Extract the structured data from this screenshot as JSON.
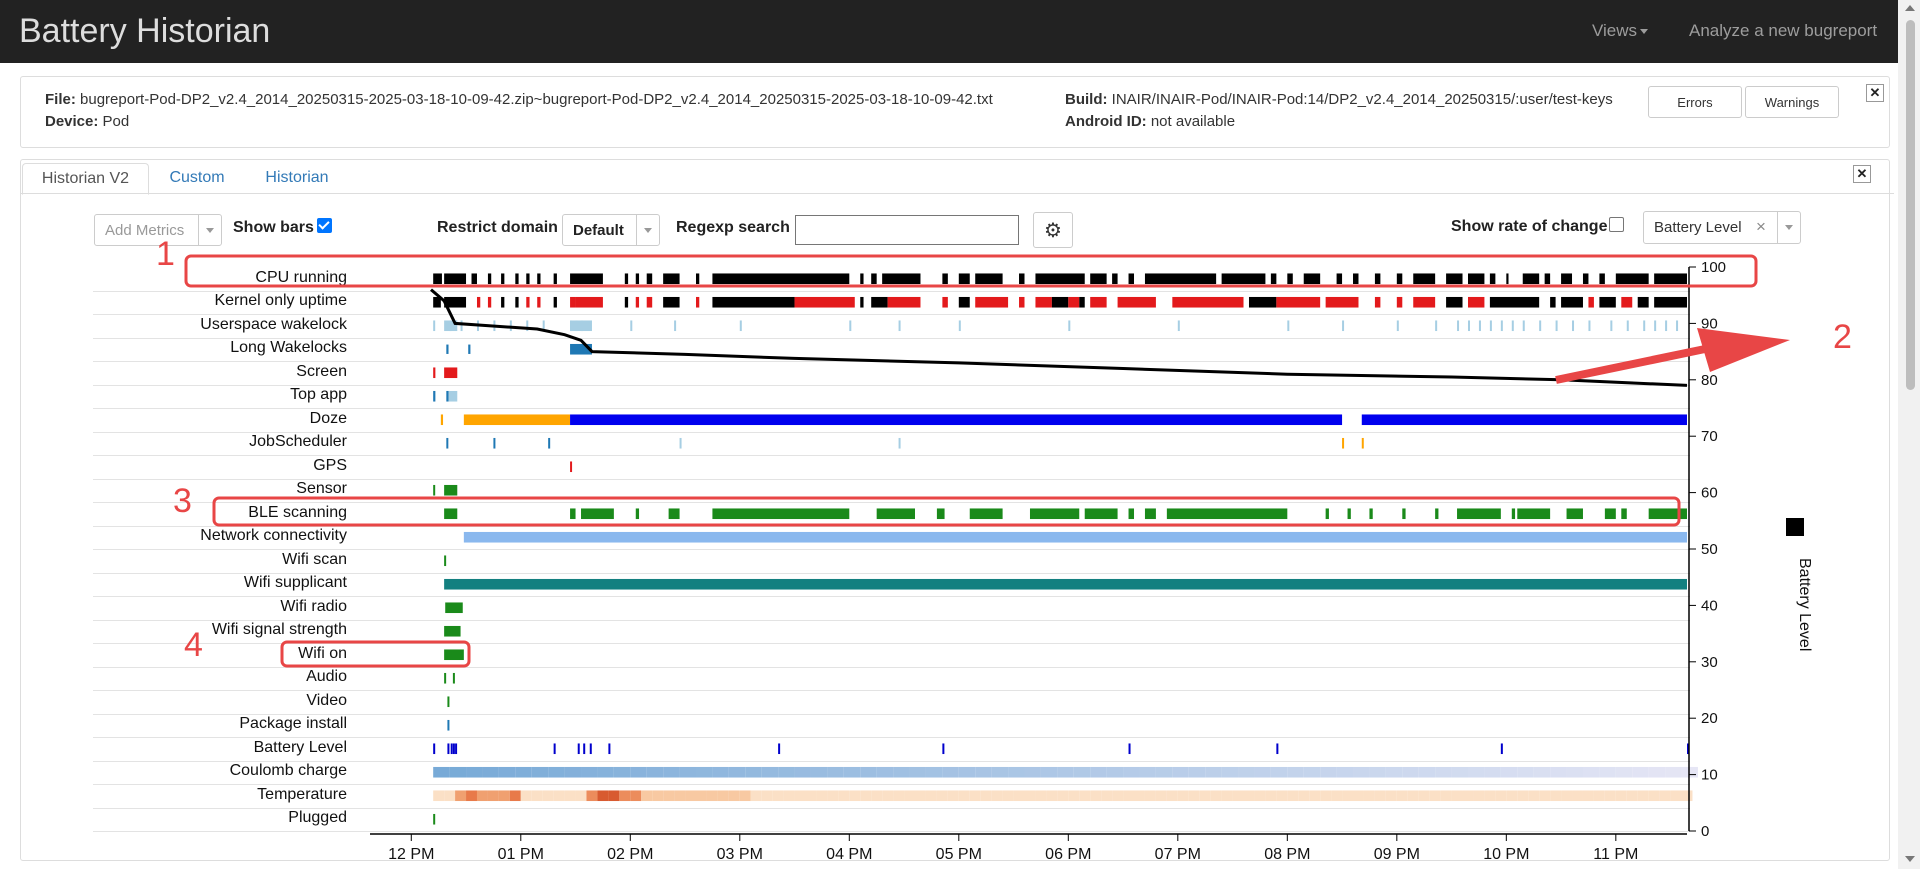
{
  "app": {
    "title": "Battery Historian",
    "nav": {
      "views": "Views",
      "analyze": "Analyze a new bugreport"
    }
  },
  "file_info": {
    "file_label": "File:",
    "file_value": "bugreport-Pod-DP2_v2.4_2014_20250315-2025-03-18-10-09-42.zip~bugreport-Pod-DP2_v2.4_2014_20250315-2025-03-18-10-09-42.txt",
    "device_label": "Device:",
    "device_value": "Pod",
    "build_label": "Build:",
    "build_value": "INAIR/INAIR-Pod/INAIR-Pod:14/DP2_v2.4_2014_20250315/:user/test-keys",
    "android_id_label": "Android ID:",
    "android_id_value": "not available",
    "errors_button": "Errors",
    "warnings_button": "Warnings",
    "close_symbol": "✕"
  },
  "tabs": [
    {
      "label": "Historian V2",
      "active": true
    },
    {
      "label": "Custom",
      "active": false
    },
    {
      "label": "Historian",
      "active": false
    }
  ],
  "toolbar": {
    "add_metrics_placeholder": "Add Metrics",
    "show_bars_label": "Show bars",
    "show_bars_checked": true,
    "restrict_domain_label": "Restrict domain",
    "restrict_domain_value": "Default",
    "regexp_search_label": "Regexp search",
    "regexp_search_value": "",
    "settings_icon": "gear-icon",
    "show_rate_label": "Show rate of change",
    "show_rate_checked": false,
    "overlay_metric_value": "Battery Level",
    "clear_symbol": "×"
  },
  "metrics": [
    "CPU running",
    "Kernel only uptime",
    "Userspace wakelock",
    "Long Wakelocks",
    "Screen",
    "Top app",
    "Doze",
    "JobScheduler",
    "GPS",
    "Sensor",
    "BLE scanning",
    "Network connectivity",
    "Wifi scan",
    "Wifi supplicant",
    "Wifi radio",
    "Wifi signal strength",
    "Wifi on",
    "Audio",
    "Video",
    "Package install",
    "Battery Level",
    "Coulomb charge",
    "Temperature",
    "Plugged"
  ],
  "chart_data": {
    "type": "timeline",
    "time_axis": {
      "tick_labels": [
        "12 PM",
        "01 PM",
        "02 PM",
        "03 PM",
        "04 PM",
        "05 PM",
        "06 PM",
        "07 PM",
        "08 PM",
        "09 PM",
        "10 PM",
        "11 PM"
      ],
      "range_hours": [
        11.97,
        23.65
      ]
    },
    "y_axis_right": {
      "label": "Battery Level",
      "range": [
        0,
        100
      ],
      "tick_labels": [
        "0",
        "10",
        "20",
        "30",
        "40",
        "50",
        "60",
        "70",
        "80",
        "90",
        "100"
      ]
    },
    "colors": {
      "cpu": "#000000",
      "kernel_red": "#e31a1c",
      "wakelock_light": "#a6cee3",
      "wakelock_dark": "#1f78b4",
      "doze_light": "#ffa500",
      "doze_deep": "#0000ee",
      "green": "#1a8a1a",
      "network": "#8ab8ee",
      "supplicant": "#138080",
      "battery_marks": "#0000cc",
      "temperature": "#f5b88a",
      "coulomb": "#9ec5e8",
      "annotation": "#e84646"
    },
    "battery_level_series": {
      "name": "Battery Level",
      "x_hours": [
        12.18,
        12.3,
        12.4,
        13.15,
        13.4,
        13.55,
        13.65,
        14.5,
        15.5,
        17.0,
        18.5,
        20.0,
        21.5,
        22.5,
        23.65
      ],
      "y_percent": [
        96,
        94,
        90,
        89,
        88,
        87,
        85,
        84.5,
        83.8,
        83,
        82,
        81,
        80.5,
        80,
        79
      ]
    },
    "annotations": [
      "1",
      "2",
      "3",
      "4"
    ]
  }
}
